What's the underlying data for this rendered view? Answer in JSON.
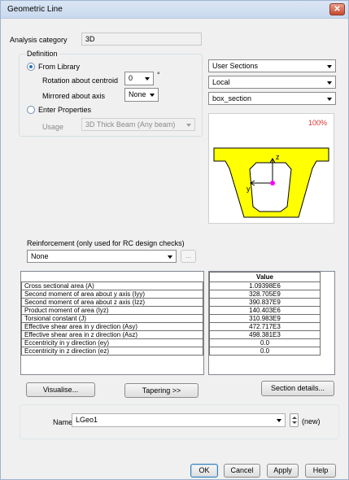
{
  "window": {
    "title": "Geometric Line",
    "close_glyph": "✕"
  },
  "analysis": {
    "label": "Analysis category",
    "value": "3D"
  },
  "definition": {
    "legend": "Definition",
    "from_library": "From Library",
    "rotation_label": "Rotation about centroid",
    "rotation_value": "0",
    "degree_symbol": "°",
    "mirrored_label": "Mirrored about axis",
    "mirrored_value": "None",
    "enter_properties": "Enter Properties",
    "usage_label": "Usage",
    "usage_value": "3D Thick Beam (Any beam)"
  },
  "library": {
    "source": "User Sections",
    "scope": "Local",
    "section": "box_section",
    "zoom": "100%",
    "colors": {
      "section_fill": "#ffff00",
      "zoom_text": "#e03030",
      "centroid": "#ff00ff"
    },
    "axis_z": "z",
    "axis_y": "y"
  },
  "reinforcement": {
    "label": "Reinforcement (only used for RC design checks)",
    "value": "None",
    "browse_label": "..."
  },
  "properties": {
    "value_header": "Value",
    "rows": [
      {
        "name": "Cross sectional area (A)",
        "value": "1.09398E6"
      },
      {
        "name": "Second moment of area about y axis (Iyy)",
        "value": "328.705E9"
      },
      {
        "name": "Second moment of area about z axis (Izz)",
        "value": "390.837E9"
      },
      {
        "name": "Product moment of area (Iyz)",
        "value": "140.403E6"
      },
      {
        "name": "Torsional constant (J)",
        "value": "310.983E9"
      },
      {
        "name": "Effective shear area in y direction (Asy)",
        "value": "472.717E3"
      },
      {
        "name": "Effective shear area in z direction (Asz)",
        "value": "498.381E3"
      },
      {
        "name": "Eccentricity in y direction (ey)",
        "value": "0.0"
      },
      {
        "name": "Eccentricity in z direction (ez)",
        "value": "0.0"
      }
    ]
  },
  "buttons": {
    "visualise": "Visualise...",
    "tapering": "Tapering >>",
    "section_details": "Section details...",
    "ok": "OK",
    "cancel": "Cancel",
    "apply": "Apply",
    "help": "Help"
  },
  "name": {
    "label": "Name",
    "value": "LGeo1",
    "status": "(new)"
  }
}
